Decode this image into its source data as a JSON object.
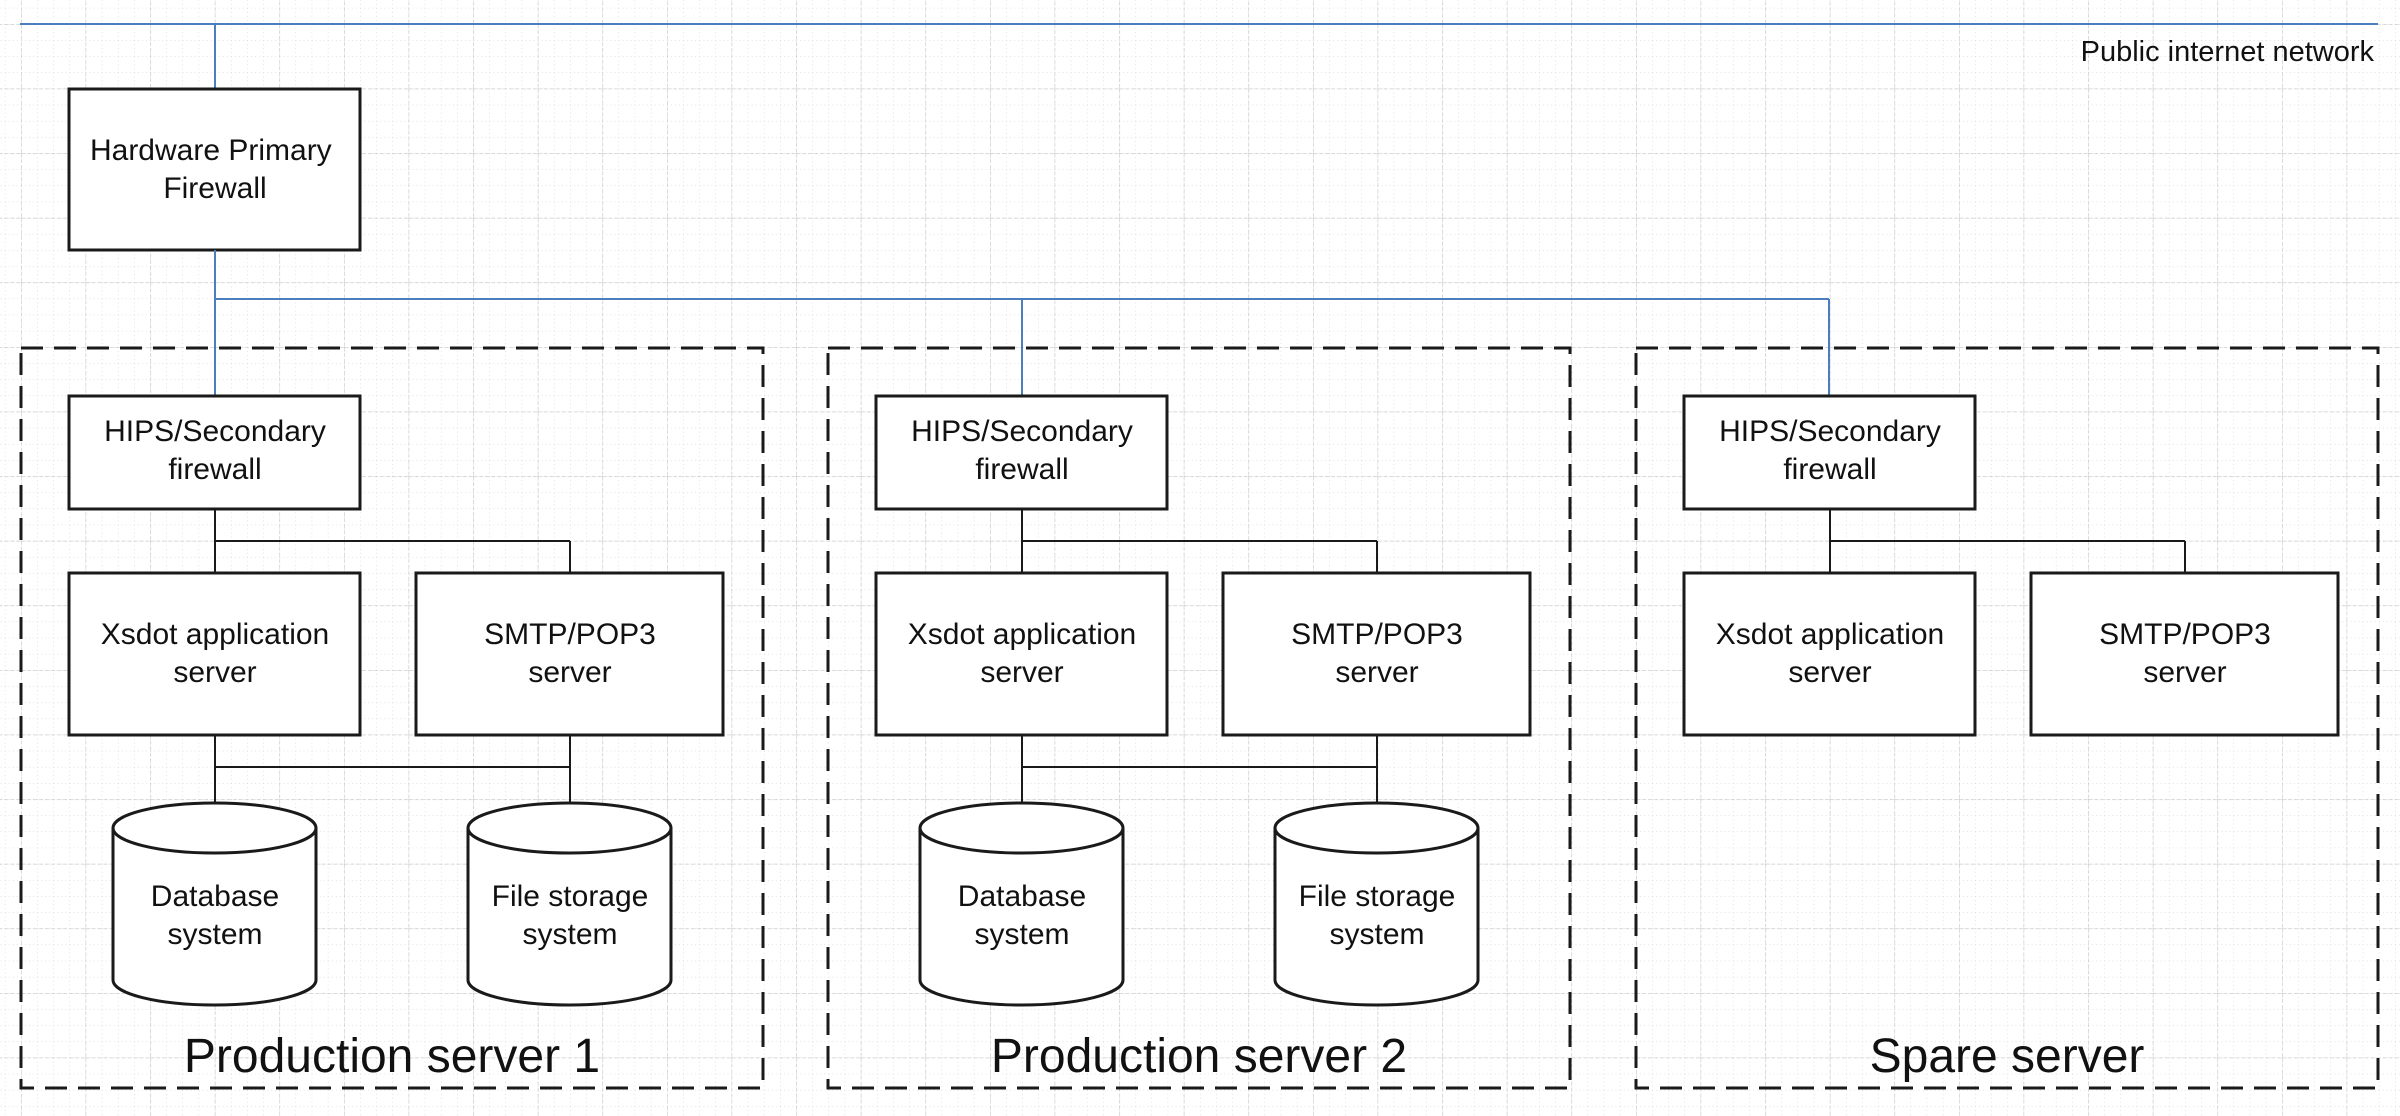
{
  "network": {
    "label": "Public internet network",
    "color": "#4a7ebf"
  },
  "primary_firewall": {
    "lines": [
      "Hardware Primary",
      "Firewall"
    ]
  },
  "groups": [
    {
      "label": "Production server 1",
      "firewall": [
        "HIPS/Secondary",
        "firewall"
      ],
      "app_server": [
        "Xsdot application",
        "server"
      ],
      "mail_server": [
        "SMTP/POP3",
        "server"
      ],
      "database": [
        "Database",
        "system"
      ],
      "file_storage": [
        "File storage",
        "system"
      ],
      "has_storage": true
    },
    {
      "label": "Production server 2",
      "firewall": [
        "HIPS/Secondary",
        "firewall"
      ],
      "app_server": [
        "Xsdot application",
        "server"
      ],
      "mail_server": [
        "SMTP/POP3",
        "server"
      ],
      "database": [
        "Database",
        "system"
      ],
      "file_storage": [
        "File storage",
        "system"
      ],
      "has_storage": true
    },
    {
      "label": "Spare server",
      "firewall": [
        "HIPS/Secondary",
        "firewall"
      ],
      "app_server": [
        "Xsdot application",
        "server"
      ],
      "mail_server": [
        "SMTP/POP3",
        "server"
      ],
      "has_storage": false
    }
  ]
}
